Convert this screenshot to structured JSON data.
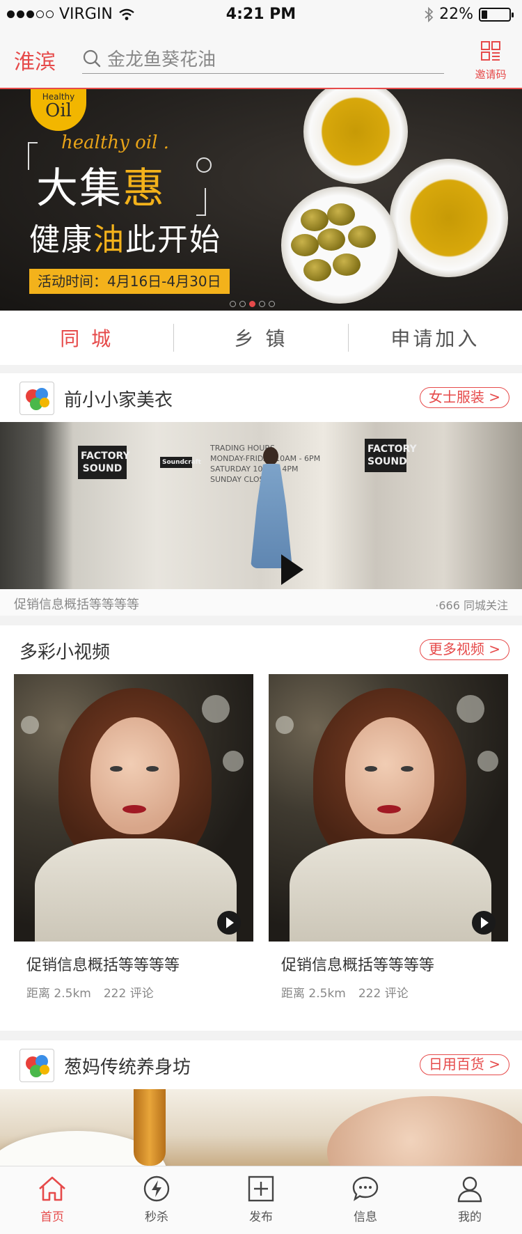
{
  "status_bar": {
    "carrier": "VIRGIN",
    "time": "4:21 PM",
    "battery": "22%",
    "battery_level": 0.22,
    "signal_dots_filled": 3,
    "signal_dots_total": 5
  },
  "header": {
    "city": "淮滨",
    "search_placeholder": "金龙鱼葵花油",
    "invite_label": "邀请码",
    "accent_color": "#e64a4a"
  },
  "banner": {
    "logo_top": "Healthy",
    "logo_big": "Oil",
    "brand_line": "healthy oil .",
    "headline1_pre": "大集",
    "headline1_hl": "惠",
    "headline2_pre": "健康",
    "headline2_hl": "油",
    "headline2_post": "此开始",
    "date_text": "活动时间：4月16日-4月30日",
    "pages": 5,
    "active_page": 3
  },
  "tabs": [
    {
      "label": "同 城",
      "active": true
    },
    {
      "label": "乡 镇",
      "active": false
    },
    {
      "label": "申请加入",
      "active": false
    }
  ],
  "store1": {
    "name": "前小小家美衣",
    "category_label": "女士服装 >",
    "sign1": "FACTORY SOUND",
    "sign2": "FACTORY SOUND",
    "sign_small": "Soundcraft",
    "hours_text": "TRADING HOURS",
    "hours_rows": [
      "MONDAY-FRIDAY 10AM - 6PM",
      "SATURDAY 10AM - 4PM",
      "SUNDAY CLOSED"
    ],
    "caption": "促销信息概括等等等等",
    "follow": "·666 同城关注"
  },
  "videos": {
    "title": "多彩小视频",
    "more_label": "更多视频 >",
    "items": [
      {
        "title": "促销信息概括等等等等",
        "distance": "距离 2.5km",
        "comments": "222 评论"
      },
      {
        "title": "促销信息概括等等等等",
        "distance": "距离 2.5km",
        "comments": "222 评论"
      }
    ]
  },
  "store2": {
    "name": "葱妈传统养身坊",
    "category_label": "日用百货 >"
  },
  "bottom_nav": [
    {
      "label": "首页",
      "icon": "home-icon",
      "active": true
    },
    {
      "label": "秒杀",
      "icon": "lightning-icon",
      "active": false
    },
    {
      "label": "发布",
      "icon": "plus-square-icon",
      "active": false
    },
    {
      "label": "信息",
      "icon": "chat-bubble-icon",
      "active": false
    },
    {
      "label": "我的",
      "icon": "user-icon",
      "active": false
    }
  ]
}
